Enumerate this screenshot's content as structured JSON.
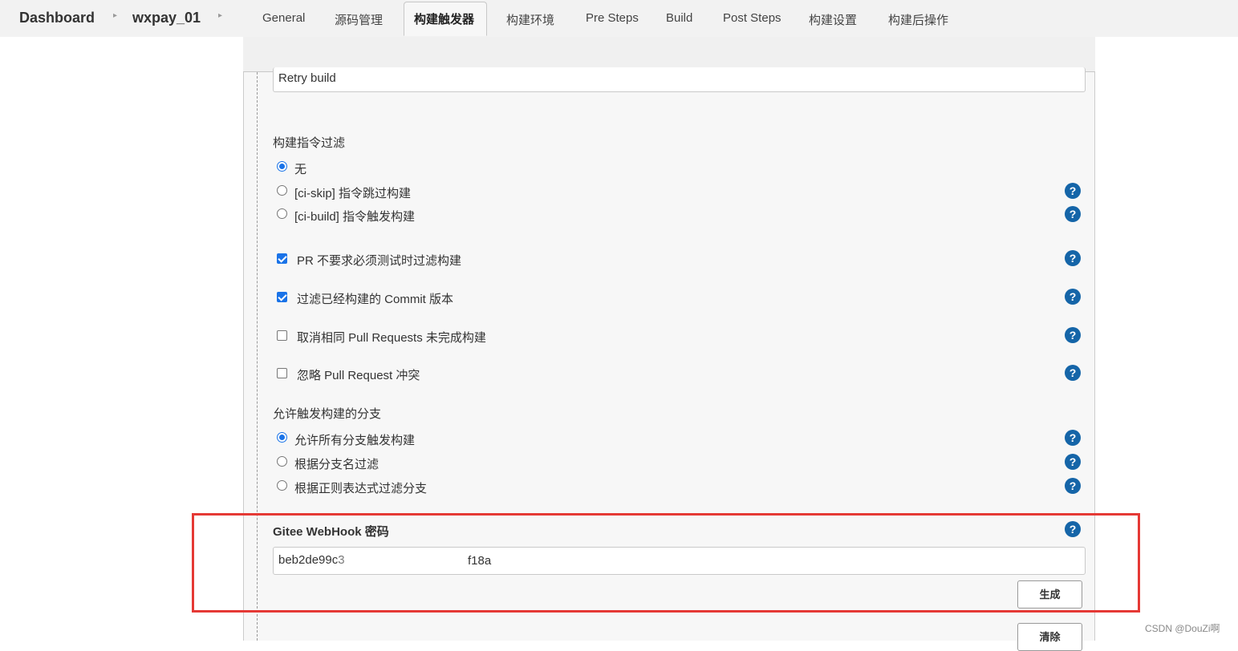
{
  "breadcrumb": {
    "item1": "Dashboard",
    "item2": "wxpay_01",
    "separator": "▸"
  },
  "tabs": [
    "General",
    "源码管理",
    "构建触发器",
    "构建环境",
    "Pre Steps",
    "Build",
    "Post Steps",
    "构建设置",
    "构建后操作"
  ],
  "active_tab": "构建触发器",
  "retry_field": {
    "value": "Retry build"
  },
  "command_filter": {
    "title": "构建指令过滤",
    "options": [
      "无",
      "[ci-skip] 指令跳过构建",
      "[ci-build] 指令触发构建"
    ],
    "selected": "无"
  },
  "checkboxes": [
    {
      "label": "PR 不要求必须测试时过滤构建",
      "checked": true
    },
    {
      "label": "过滤已经构建的 Commit 版本",
      "checked": true
    },
    {
      "label": "取消相同 Pull Requests 未完成构建",
      "checked": false
    },
    {
      "label": "忽略 Pull Request 冲突",
      "checked": false
    }
  ],
  "branch_filter": {
    "title": "允许触发构建的分支",
    "options": [
      "允许所有分支触发构建",
      "根据分支名过滤",
      "根据正则表达式过滤分支"
    ],
    "selected": "允许所有分支触发构建"
  },
  "webhook": {
    "title": "Gitee WebHook 密码",
    "value": "beb2de99c3",
    "value_tail": "f18a",
    "generate_label": "生成"
  },
  "clear_label": "清除",
  "help_glyph": "?",
  "watermark": "CSDN @DouZi啊",
  "colors": {
    "accent": "#1a73e8",
    "help": "#1565a8",
    "highlight": "#e53935"
  }
}
